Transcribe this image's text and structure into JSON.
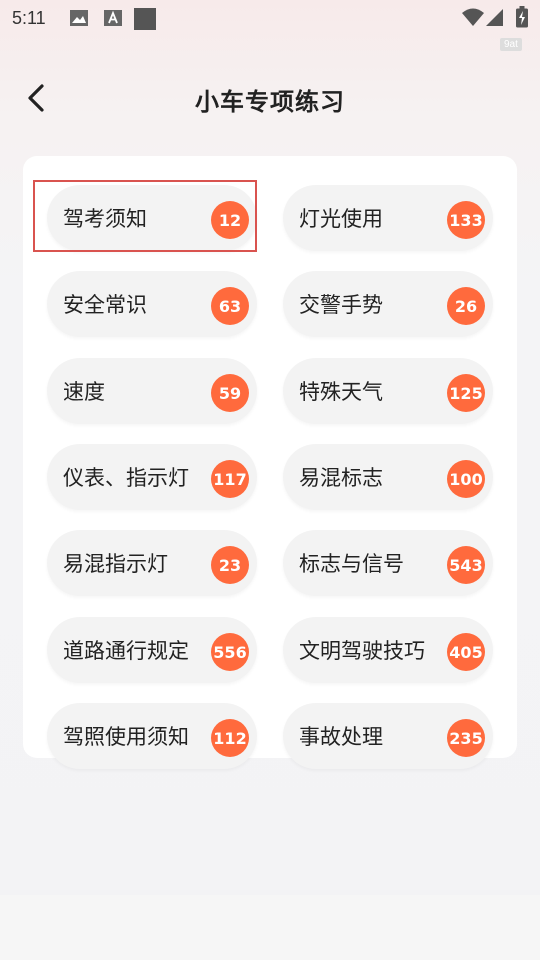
{
  "status_bar": {
    "time": "5:11",
    "icons": [
      "photo-icon",
      "text-a-icon",
      "square-icon",
      "wifi-icon",
      "signal-icon",
      "battery-icon"
    ],
    "tag": "9at"
  },
  "header": {
    "title": "小车专项练习",
    "back_icon": "chevron-left-icon"
  },
  "colors": {
    "accent": "#ff6a3d",
    "highlight": "#d9534f"
  },
  "categories": [
    {
      "label": "驾考须知",
      "count": "12"
    },
    {
      "label": "灯光使用",
      "count": "133"
    },
    {
      "label": "安全常识",
      "count": "63"
    },
    {
      "label": "交警手势",
      "count": "26"
    },
    {
      "label": "速度",
      "count": "59"
    },
    {
      "label": "特殊天气",
      "count": "125"
    },
    {
      "label": "仪表、指示灯",
      "count": "117"
    },
    {
      "label": "易混标志",
      "count": "100"
    },
    {
      "label": "易混指示灯",
      "count": "23"
    },
    {
      "label": "标志与信号",
      "count": "543"
    },
    {
      "label": "道路通行规定",
      "count": "556"
    },
    {
      "label": "文明驾驶技巧",
      "count": "405"
    },
    {
      "label": "驾照使用须知",
      "count": "112"
    },
    {
      "label": "事故处理",
      "count": "235"
    }
  ]
}
